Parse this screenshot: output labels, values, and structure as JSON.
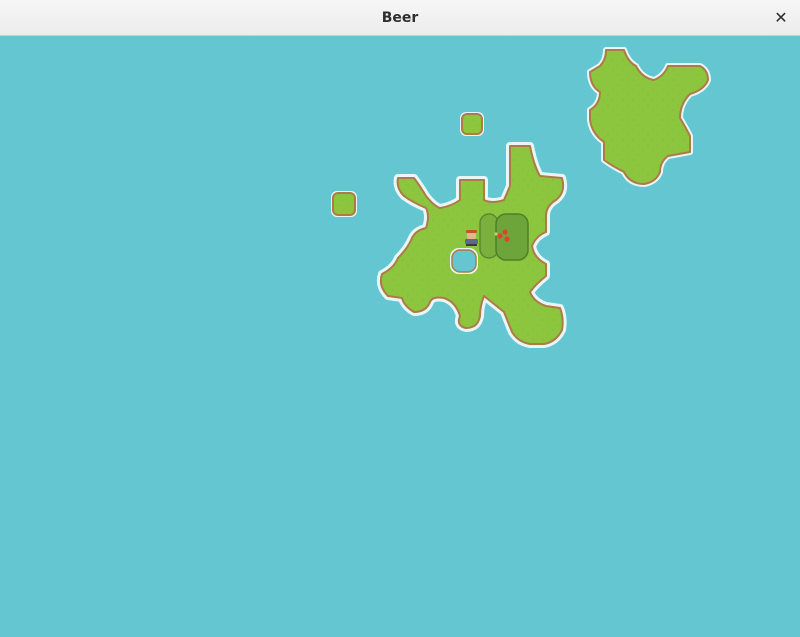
{
  "window": {
    "title": "Beer",
    "close_icon": "close-icon"
  },
  "scene": {
    "water_color": "#63c6d0",
    "grass_color": "#8cc63f",
    "shore_color": "#b07a44",
    "bush_color": "#6c9e3c",
    "berry_color": "#e0442c",
    "islands": [
      "main-island",
      "northeast-island",
      "small-island-north",
      "small-island-west"
    ],
    "entities": [
      "player-character",
      "berry-bush"
    ]
  }
}
